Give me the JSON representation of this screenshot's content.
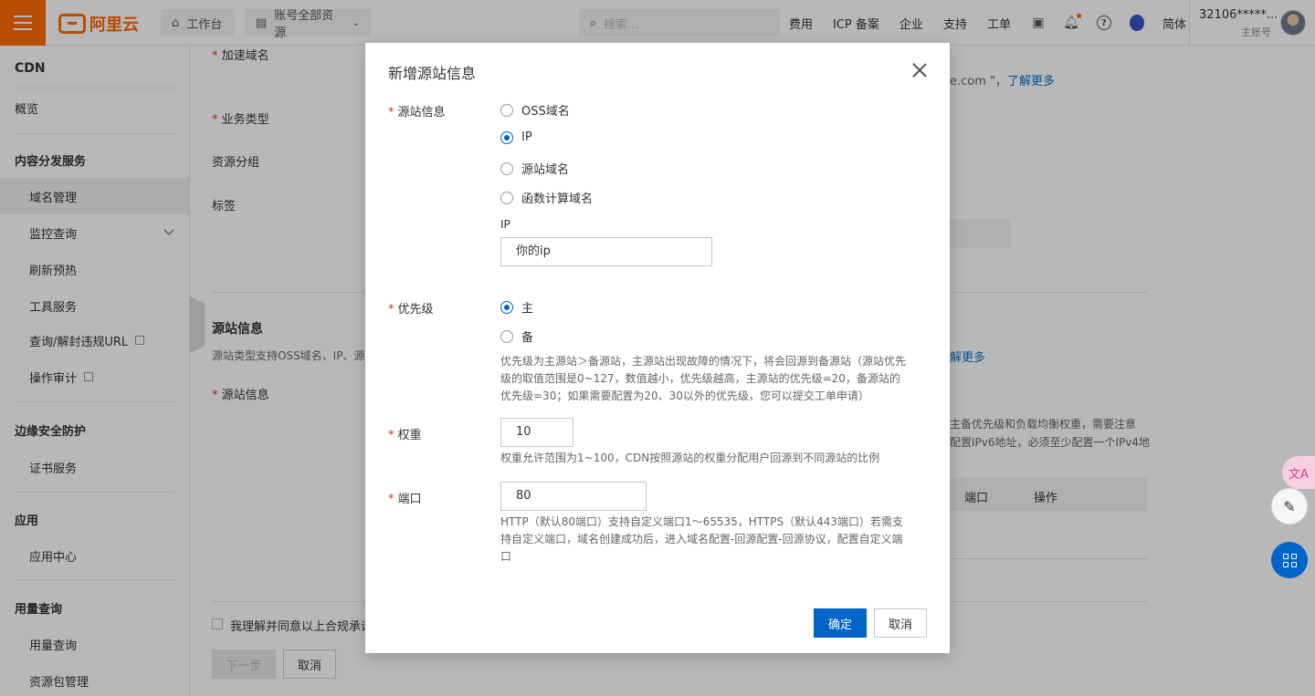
{
  "topbar": {
    "logo_text": "阿里云",
    "workbench": "工作台",
    "resource_scope": "账号全部资源",
    "search_placeholder": "搜索...",
    "links": [
      "费用",
      "ICP 备案",
      "企业",
      "支持",
      "工单"
    ],
    "lang": "简体",
    "account": "32106*****...",
    "account_role": "主账号"
  },
  "sidebar": {
    "title": "CDN",
    "overview": "概览",
    "group_content": "内容分发服务",
    "domain_mgmt": "域名管理",
    "monitor": "监控查询",
    "refresh": "刷新预热",
    "tools": "工具服务",
    "illegal_url": "查询/解封违规URL",
    "audit": "操作审计",
    "group_edge": "边缘安全防护",
    "cert": "证书服务",
    "group_app": "应用",
    "app_center": "应用中心",
    "group_usage": "用量查询",
    "usage": "用量查询",
    "package": "资源包管理"
  },
  "main": {
    "accel_domain": "加速域名",
    "hint_tail": "e.com \"，",
    "learn_more": "了解更多",
    "biz_type": "业务类型",
    "resource_group": "资源分组",
    "tags": "标签",
    "origin_section": "源站信息",
    "origin_desc": "源站类型支持OSS域名、IP、源",
    "learn_more2": "解更多",
    "origin_field": "源站信息",
    "right_hint1": "主备优先级和负载均衡权重，需要注意",
    "right_hint2": "配置IPv6地址，必须至少配置一个IPv4地",
    "col_port": "端口",
    "col_op": "操作",
    "agree": "我理解并同意以上合规承诺",
    "next": "下一步",
    "cancel": "取消"
  },
  "modal": {
    "title": "新增源站信息",
    "origin_label": "源站信息",
    "origin_options": [
      "OSS域名",
      "IP",
      "源站域名",
      "函数计算域名"
    ],
    "origin_selected": "IP",
    "ip_label": "IP",
    "ip_value": "你的ip",
    "priority_label": "优先级",
    "priority_options": [
      "主",
      "备"
    ],
    "priority_selected": "主",
    "priority_help": "优先级为主源站＞备源站，主源站出现故障的情况下，将会回源到备源站（源站优先级的取值范围是0~127，数值越小，优先级越高，主源站的优先级=20，备源站的优先级=30；如果需要配置为20、30以外的优先级，您可以提交工单申请）",
    "weight_label": "权重",
    "weight_value": "10",
    "weight_help": "权重允许范围为1~100，CDN按照源站的权重分配用户回源到不同源站的比例",
    "port_label": "端口",
    "port_value": "80",
    "port_help": "HTTP（默认80端口）支持自定义端口1～65535，HTTPS（默认443端口）若需支持自定义端口，域名创建成功后，进入域名配置-回源配置-回源协议，配置自定义端口",
    "ok": "确定",
    "cancel": "取消"
  },
  "float": {
    "translate": "文A"
  },
  "colors": {
    "brand": "#ff6a00",
    "primary": "#0064c8",
    "required": "#d93026"
  }
}
